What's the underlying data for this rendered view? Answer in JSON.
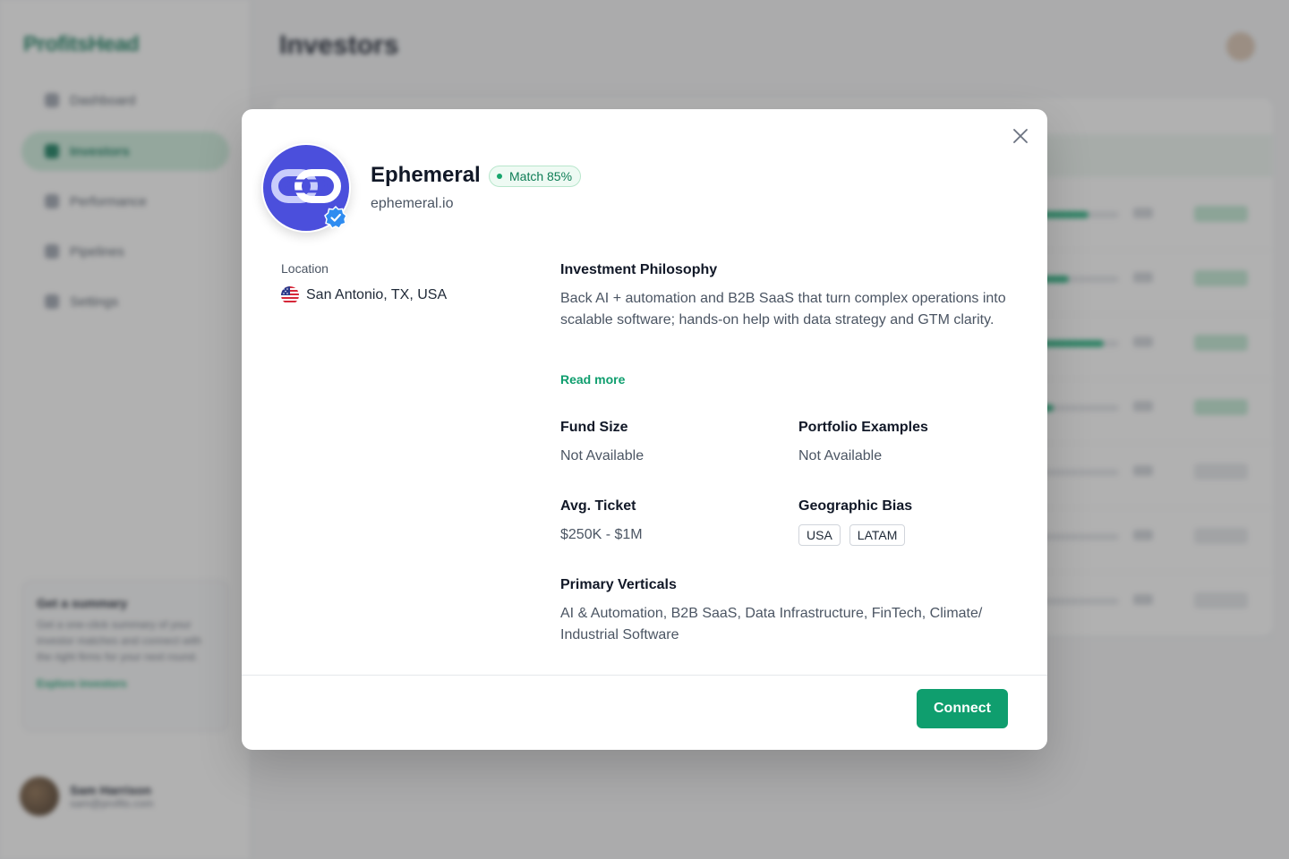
{
  "background": {
    "brand": "ProfitsHead",
    "page_title": "Investors",
    "nav": [
      "Dashboard",
      "Investors",
      "Performance",
      "Pipelines",
      "Settings"
    ],
    "tip": {
      "title": "Get a summary",
      "body": "Get a one-click summary of your investor matches and connect with the right firms for your next round.",
      "link": "Explore investors"
    },
    "user": {
      "name": "Sam Harrison",
      "email": "sam@profits.com"
    }
  },
  "modal": {
    "company_name": "Ephemeral",
    "match_label": "Match 85%",
    "match_score": 85,
    "company_url": "ephemeral.io",
    "location_label": "Location",
    "location_value": "San Antonio, TX, USA",
    "philosophy_title": "Investment Philosophy",
    "philosophy_text": "Back AI + automation and B2B SaaS that turn complex operations into scalable software; hands-on help with data strategy and GTM clarity.",
    "read_more": "Read more",
    "fund_size_title": "Fund Size",
    "fund_size_value": "Not Available",
    "portfolio_title": "Portfolio Examples",
    "portfolio_value": "Not Available",
    "ticket_title": "Avg. Ticket",
    "ticket_value": "$250K - $1M",
    "geo_title": "Geographic Bias",
    "geo_tags": [
      "USA",
      "LATAM"
    ],
    "verticals_title": "Primary Verticals",
    "verticals_text": "AI & Automation, B2B SaaS, Data Infrastructure, FinTech, Climate/ Industrial Software",
    "connect_label": "Connect",
    "colors": {
      "accent": "#0f9e6e",
      "logo_bg": "#4b4fdc",
      "verified": "#2f8cf0",
      "match_bg": "#eefaf3"
    },
    "icons": [
      "close-icon",
      "link-logo-icon",
      "verified-badge-icon",
      "us-flag-icon"
    ]
  }
}
